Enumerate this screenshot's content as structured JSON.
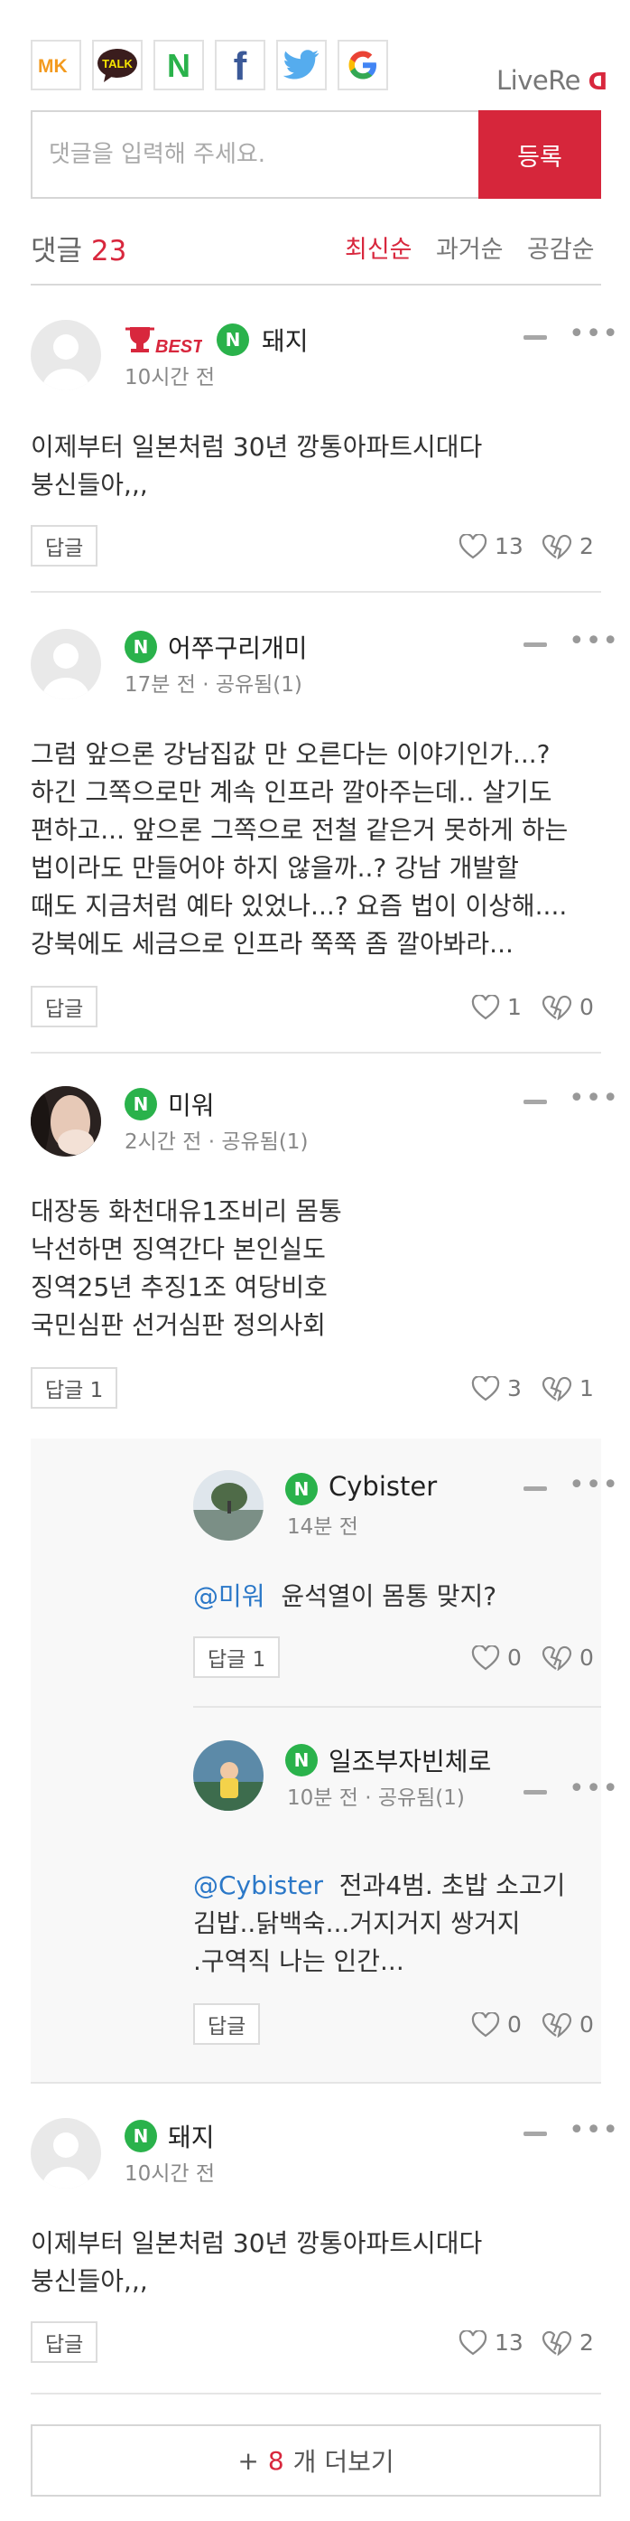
{
  "share": {
    "buttons": [
      {
        "label": "MK",
        "icon": "mk-icon"
      },
      {
        "label": "TALK",
        "icon": "kakaotalk-icon"
      },
      {
        "label": "N",
        "icon": "naver-icon"
      },
      {
        "label": "f",
        "icon": "facebook-icon"
      },
      {
        "label": "",
        "icon": "twitter-icon"
      },
      {
        "label": "G",
        "icon": "google-icon"
      }
    ]
  },
  "brand": {
    "name_light": "LiveRe",
    "name_accent": "ᗡ"
  },
  "comment_input": {
    "placeholder": "댓글을 입력해 주세요.",
    "submit": "등록"
  },
  "summary": {
    "label": "댓글",
    "count": "23"
  },
  "sort": {
    "latest": "최신순",
    "oldest": "과거순",
    "empathy": "공감순"
  },
  "comments": [
    {
      "badge": "BEST",
      "platform": "N",
      "name": "돼지",
      "meta": "10시간 전",
      "lines": [
        "이제부터 일본처럼 30년 깡통아파트시대다",
        "붕신들아,,,"
      ],
      "reply": "답글",
      "likes": "13",
      "dislikes": "2"
    },
    {
      "platform": "N",
      "name": "어쭈구리개미",
      "meta": "17분 전 · 공유됨(1)",
      "lines": [
        "그럼 앞으론 강남집값 만 오른다는 이야기인가...?",
        "하긴 그쪽으로만 계속 인프라 깔아주는데.. 살기도",
        "편하고... 앞으론 그쪽으로 전철 같은거 못하게 하는",
        "법이라도 만들어야 하지 않을까..? 강남 개발할",
        "때도 지금처럼 예타 있었나...? 요즘 법이 이상해....",
        "강북에도 세금으로 인프라 쭉쭉 좀 깔아봐라..."
      ],
      "reply": "답글",
      "likes": "1",
      "dislikes": "0"
    },
    {
      "platform": "N",
      "name": "미워",
      "meta": "2시간 전 · 공유됨(1)",
      "lines": [
        "대장동 화천대유1조비리 몸통",
        "낙선하면 징역간다 본인실도",
        "징역25년 추징1조 여당비호",
        "국민심판 선거심판 정의사회"
      ],
      "reply": "답글 1",
      "likes": "3",
      "dislikes": "1"
    },
    {
      "platform": "N",
      "name": "돼지",
      "meta": "10시간 전",
      "lines": [
        "이제부터 일본처럼 30년 깡통아파트시대다",
        "붕신들아,,,"
      ],
      "reply": "답글",
      "likes": "13",
      "dislikes": "2"
    }
  ],
  "replies": [
    {
      "platform": "N",
      "name": "Cybister",
      "meta": "14분 전",
      "mention": "@미워",
      "text": "윤석열이 몸통 맞지?",
      "reply": "답글 1",
      "likes": "0",
      "dislikes": "0"
    },
    {
      "platform": "N",
      "name": "일조부자빈체로",
      "meta": "10분 전 · 공유됨(1)",
      "mention": "@Cybister",
      "lines": [
        "전과4범. 초밥 소고기",
        "김밥..닭백숙...거지거지 쌍거지",
        ".구역직 나는 인간..."
      ],
      "reply": "답글",
      "likes": "0",
      "dislikes": "0"
    }
  ],
  "load_more": {
    "prefix": "+",
    "count": "8",
    "suffix": "개 더보기"
  },
  "colors": {
    "accent": "#d6263b",
    "naver": "#2ab24b",
    "mention": "#2b78c8"
  }
}
